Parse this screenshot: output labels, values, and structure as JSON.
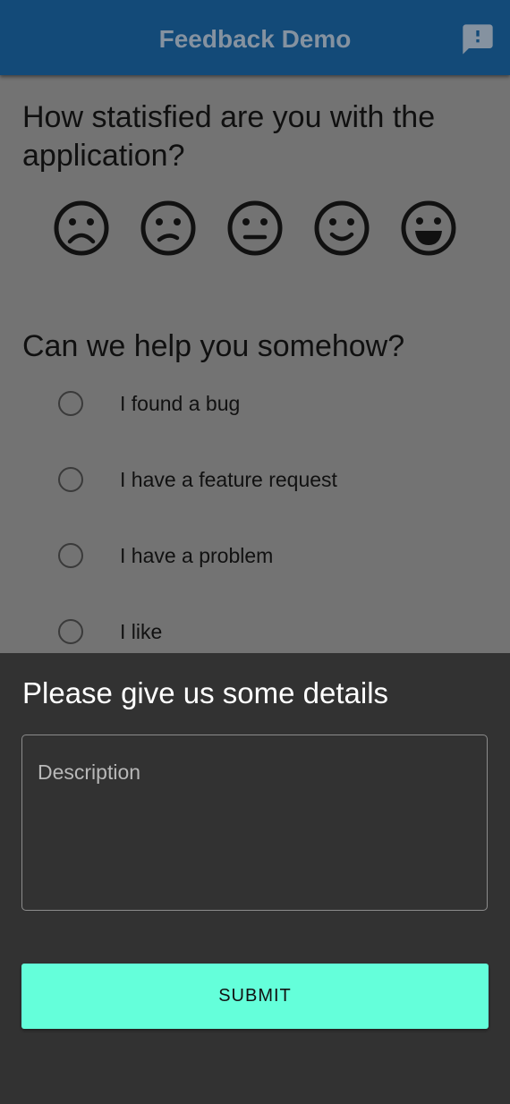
{
  "appbar": {
    "title": "Feedback Demo",
    "action_icon": "feedback-icon"
  },
  "colors": {
    "appbar_bg": "#134a78",
    "page_dimmed_bg": "#737373",
    "sheet_bg": "#323232",
    "accent": "#64ffda"
  },
  "satisfaction": {
    "question": "How statisfied are you with the application?",
    "faces": [
      {
        "name": "very-dissatisfied-icon",
        "label": "very dissatisfied"
      },
      {
        "name": "dissatisfied-icon",
        "label": "dissatisfied"
      },
      {
        "name": "neutral-icon",
        "label": "neutral"
      },
      {
        "name": "satisfied-icon",
        "label": "satisfied"
      },
      {
        "name": "very-satisfied-icon",
        "label": "very satisfied"
      }
    ]
  },
  "help": {
    "question": "Can we help you somehow?",
    "options": [
      {
        "label": "I found a bug",
        "selected": false
      },
      {
        "label": "I have a feature request",
        "selected": false
      },
      {
        "label": "I have a problem",
        "selected": false
      },
      {
        "label": "I like",
        "selected": false
      }
    ]
  },
  "details_sheet": {
    "title": "Please give us some details",
    "description": {
      "placeholder": "Description",
      "value": ""
    },
    "submit_label": "SUBMIT"
  }
}
